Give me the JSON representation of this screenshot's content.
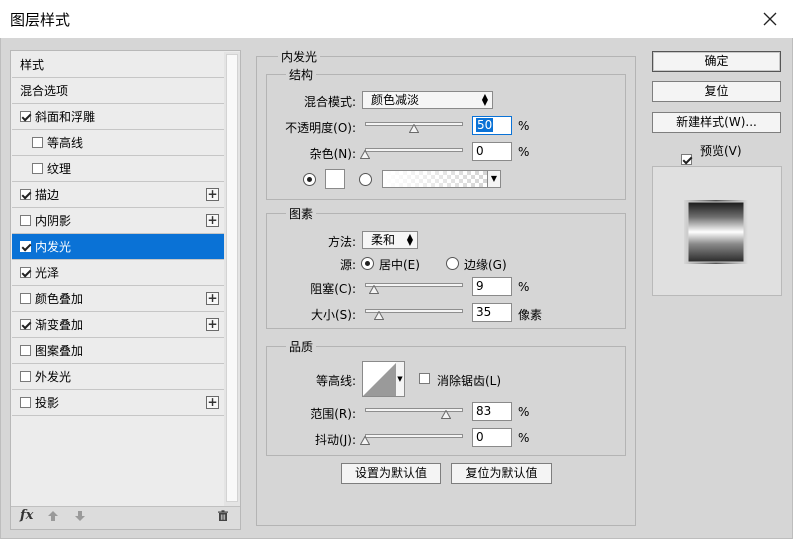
{
  "window": {
    "title": "图层样式"
  },
  "styles": {
    "items": [
      {
        "label": "样式",
        "has_checkbox": false,
        "checked": false,
        "has_add": false,
        "selected": false
      },
      {
        "label": "混合选项",
        "has_checkbox": false,
        "checked": false,
        "has_add": false,
        "selected": false
      },
      {
        "label": "斜面和浮雕",
        "has_checkbox": true,
        "checked": true,
        "has_add": false,
        "selected": false
      },
      {
        "label": "等高线",
        "has_checkbox": true,
        "checked": false,
        "has_add": false,
        "selected": false,
        "indent": true
      },
      {
        "label": "纹理",
        "has_checkbox": true,
        "checked": false,
        "has_add": false,
        "selected": false,
        "indent": true
      },
      {
        "label": "描边",
        "has_checkbox": true,
        "checked": true,
        "has_add": true,
        "selected": false
      },
      {
        "label": "内阴影",
        "has_checkbox": true,
        "checked": false,
        "has_add": true,
        "selected": false
      },
      {
        "label": "内发光",
        "has_checkbox": true,
        "checked": true,
        "has_add": false,
        "selected": true
      },
      {
        "label": "光泽",
        "has_checkbox": true,
        "checked": true,
        "has_add": false,
        "selected": false
      },
      {
        "label": "颜色叠加",
        "has_checkbox": true,
        "checked": false,
        "has_add": true,
        "selected": false
      },
      {
        "label": "渐变叠加",
        "has_checkbox": true,
        "checked": true,
        "has_add": true,
        "selected": false
      },
      {
        "label": "图案叠加",
        "has_checkbox": true,
        "checked": false,
        "has_add": false,
        "selected": false
      },
      {
        "label": "外发光",
        "has_checkbox": true,
        "checked": false,
        "has_add": false,
        "selected": false
      },
      {
        "label": "投影",
        "has_checkbox": true,
        "checked": false,
        "has_add": true,
        "selected": false
      }
    ],
    "footer_fx": "fx"
  },
  "inner_glow": {
    "title": "内发光",
    "structure": {
      "title": "结构",
      "blend_mode_label": "混合模式:",
      "blend_mode_value": "颜色减淡",
      "opacity_label": "不透明度(O):",
      "opacity_value": "50",
      "opacity_unit": "%",
      "opacity_level": 0.5,
      "noise_label": "杂色(N):",
      "noise_value": "0",
      "noise_unit": "%",
      "noise_level": 0
    },
    "elements": {
      "title": "图素",
      "method_label": "方法:",
      "method_value": "柔和",
      "source_label": "源:",
      "source_center": "居中(E)",
      "source_edge": "边缘(G)",
      "choke_label": "阻塞(C):",
      "choke_value": "9",
      "choke_unit": "%",
      "choke_level": 0.09,
      "size_label": "大小(S):",
      "size_value": "35",
      "size_unit": "像素",
      "size_level": 0.14
    },
    "quality": {
      "title": "品质",
      "contour_label": "等高线:",
      "antialias_label": "消除锯齿(L)",
      "range_label": "范围(R):",
      "range_value": "83",
      "range_unit": "%",
      "range_level": 0.83,
      "jitter_label": "抖动(J):",
      "jitter_value": "0",
      "jitter_unit": "%",
      "jitter_level": 0
    },
    "make_default": "设置为默认值",
    "reset_default": "复位为默认值"
  },
  "buttons": {
    "ok": "确定",
    "reset": "复位",
    "new_style": "新建样式(W)...",
    "preview_label": "预览(V)",
    "preview_checked": true
  },
  "colors": {
    "selection_blue": "#0a72d6",
    "dialog_bg": "#d6d6d6",
    "glow_color": "#ffffff"
  }
}
